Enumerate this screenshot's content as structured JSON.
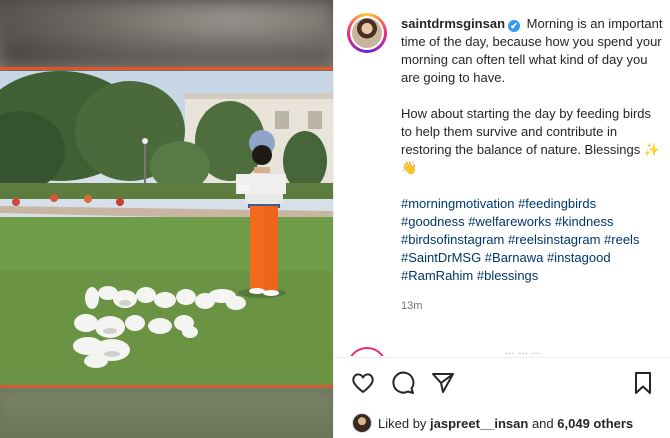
{
  "post": {
    "username": "saintdrmsginsan",
    "verified_mark": "✔",
    "caption_lines": [
      "Morning is an important time of the day, because how you spend your morning can often tell what kind of day you are going to have."
    ],
    "caption_para2": "How about starting the day by feeding birds to help them survive and contribute in restoring the balance of nature. Blessings ✨👋",
    "hashtags": "#morningmotivation #feedingbirds #goodness #welfareworks #kindness #birdsofinstagram #reelsinstagram #reels #SaintDrMSG #Barnawa #instagood #RamRahim #blessings",
    "time": "13m"
  },
  "actions": {
    "like_icon": "heart-icon",
    "comment_icon": "comment-icon",
    "share_icon": "share-icon",
    "save_icon": "bookmark-icon"
  },
  "likes": {
    "prefix": "Liked by",
    "user": "jaspreet__insan",
    "middle": "and",
    "count": "6,049 others"
  },
  "colors": {
    "frame_accent": "#e2562a",
    "hashtag": "#00376b",
    "verified": "#3897f0",
    "pigeon": "#f4f4f2",
    "orange_pants": "#f26a1c"
  }
}
